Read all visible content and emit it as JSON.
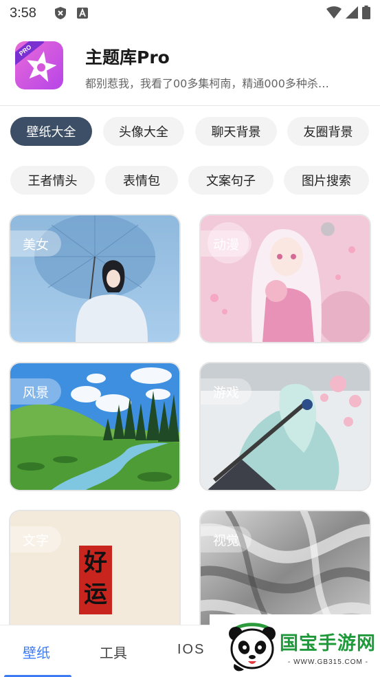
{
  "status_bar": {
    "time": "3:58"
  },
  "header": {
    "logo_badge": "PRO",
    "title": "主题库Pro",
    "description": "都别惹我，我看了00多集柯南，精通000多种杀…"
  },
  "chips_row1": [
    "壁纸大全",
    "头像大全",
    "聊天背景",
    "友圈背景"
  ],
  "chips_row2": [
    "王者情头",
    "表情包",
    "文案句子",
    "图片搜索"
  ],
  "active_chip": "壁纸大全",
  "cards": [
    {
      "label": "美女"
    },
    {
      "label": "动漫"
    },
    {
      "label": "风景"
    },
    {
      "label": "游戏"
    },
    {
      "label": "文字",
      "image_text": [
        "好",
        "运"
      ]
    },
    {
      "label": "视觉"
    }
  ],
  "bottom_nav": {
    "items": [
      "壁纸",
      "工具",
      "IOS"
    ],
    "active": "壁纸"
  },
  "watermark": {
    "brand": "国宝手游网",
    "url": "- WWW.GB315.COM -"
  },
  "colors": {
    "accent": "#3d7bf5",
    "active_chip": "#3d4f66",
    "watermark_green": "#1e9a3a"
  }
}
